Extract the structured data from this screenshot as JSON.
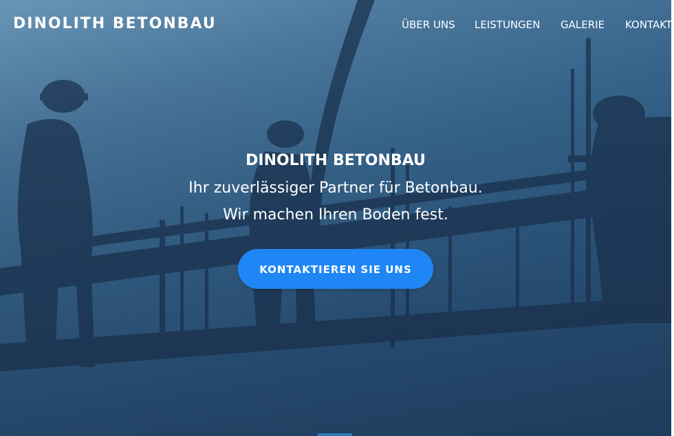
{
  "header": {
    "logo": "DINOLITH BETONBAU",
    "nav": [
      {
        "label": "ÜBER UNS"
      },
      {
        "label": "LEISTUNGEN"
      },
      {
        "label": "GALERIE"
      },
      {
        "label": "KONTAKT"
      }
    ]
  },
  "hero": {
    "title": "DINOLITH BETONBAU",
    "line1": "Ihr zuverlässiger Partner für Betonbau.",
    "line2": "Wir machen Ihren Boden fest.",
    "cta_label": "KONTAKTIEREN SIE UNS"
  },
  "colors": {
    "accent": "#1f86f5",
    "hero_overlay": "#2e5a83"
  },
  "icons": {
    "background": "construction-workers-silhouette-image"
  }
}
